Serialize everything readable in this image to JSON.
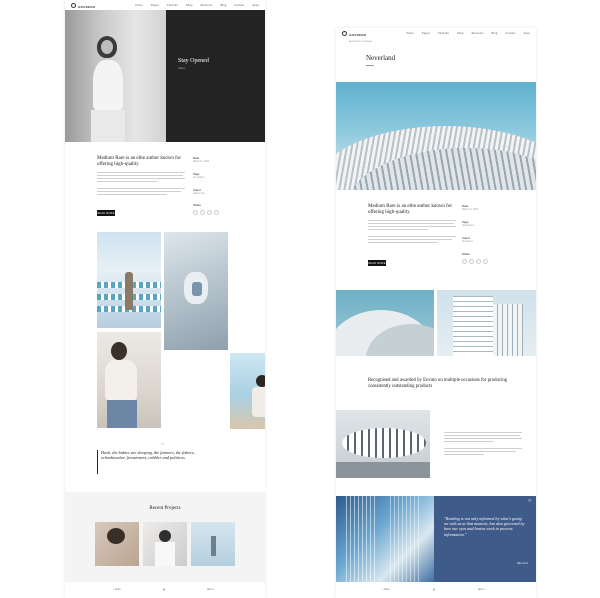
{
  "left": {
    "logo": {
      "name": "GRADERO",
      "tagline": "ARCHITECTS & DESIGN"
    },
    "nav": [
      "Home",
      "Pages",
      "Portfolio",
      "Shop",
      "Elements",
      "Blog",
      "Contact",
      "Apps"
    ],
    "hero": {
      "title": "Stay Opened",
      "subtitle": "Gallery"
    },
    "intro": {
      "heading": "Medium Rare is an elite author known for offering high-quality",
      "button": "READ MORE"
    },
    "sidebar": [
      {
        "label": "Date",
        "value": "March 14, 2023"
      },
      {
        "label": "Tags",
        "value": "Art, Gallery"
      },
      {
        "label": "Client",
        "value": "Gallery Arte"
      },
      {
        "label": "Share",
        "value": ""
      }
    ],
    "quote": "Hush, the babies are sleeping, the farmers, the fishers, schoolteacher, fernsinners, cobbler and politicos.",
    "recent": {
      "title": "Recent Projects"
    },
    "footer": [
      "« PREV",
      "▦",
      "NEXT »"
    ]
  },
  "right": {
    "logo": {
      "name": "GRADERO",
      "tagline": "ARCHITECTS & DESIGN"
    },
    "nav": [
      "Home",
      "Pages",
      "Portfolio",
      "Shop",
      "Elements",
      "Blog",
      "Contact",
      "Apps"
    ],
    "title": "Neverland",
    "intro": {
      "heading": "Medium Rare is an elite author known for offering high-quality",
      "button": "READ MORE"
    },
    "sidebar": [
      {
        "label": "Date",
        "value": "March 14, 2023"
      },
      {
        "label": "Tags",
        "value": "Architecture"
      },
      {
        "label": "Client",
        "value": "Neverland"
      },
      {
        "label": "Share",
        "value": ""
      }
    ],
    "award": "Recognised and awarded by Envato on multiple occasions for producing consistently outstanding products",
    "quote": "\"Reading is not only informed by what's going on with us at that moment, but also governed by how our eyes and brains work to process information.\"",
    "quote_author": "Mike Scott",
    "footer": [
      "« PREV",
      "▦",
      "NEXT »"
    ]
  },
  "colors": {
    "dark": "#222222",
    "quote_blue": "#3f5b8a",
    "page_bg": "#ffffff",
    "gray_section": "#f4f4f5"
  }
}
